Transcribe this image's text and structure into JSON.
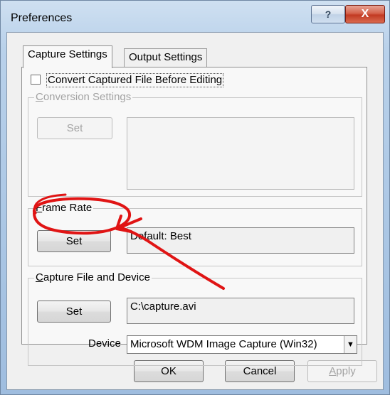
{
  "window": {
    "title": "Preferences",
    "help_glyph": "?",
    "close_glyph": "X"
  },
  "tabs": [
    {
      "label": "Capture Settings"
    },
    {
      "label": "Output Settings"
    }
  ],
  "convert_checkbox": {
    "checked": false,
    "label": "Convert Captured File Before Editing"
  },
  "conversion_group": {
    "label_prefix": "C",
    "label_rest": "onversion Settings",
    "set_label": "Set",
    "value": ""
  },
  "frame_rate_group": {
    "label_prefix": "F",
    "label_rest": "rame Rate",
    "set_label": "Set",
    "value": "Default: Best"
  },
  "capture_group": {
    "label_prefix": "C",
    "label_rest": "apture File and Device",
    "set_label": "Set",
    "value": "C:\\capture.avi",
    "device_label": "Device",
    "device_value": "Microsoft WDM Image Capture (Win32)",
    "dropdown_glyph": "▼"
  },
  "footer": {
    "ok_label": "OK",
    "cancel_label": "Cancel",
    "apply_label_prefix": "A",
    "apply_label_rest": "pply"
  },
  "colors": {
    "annotation_red": "#e01414"
  }
}
